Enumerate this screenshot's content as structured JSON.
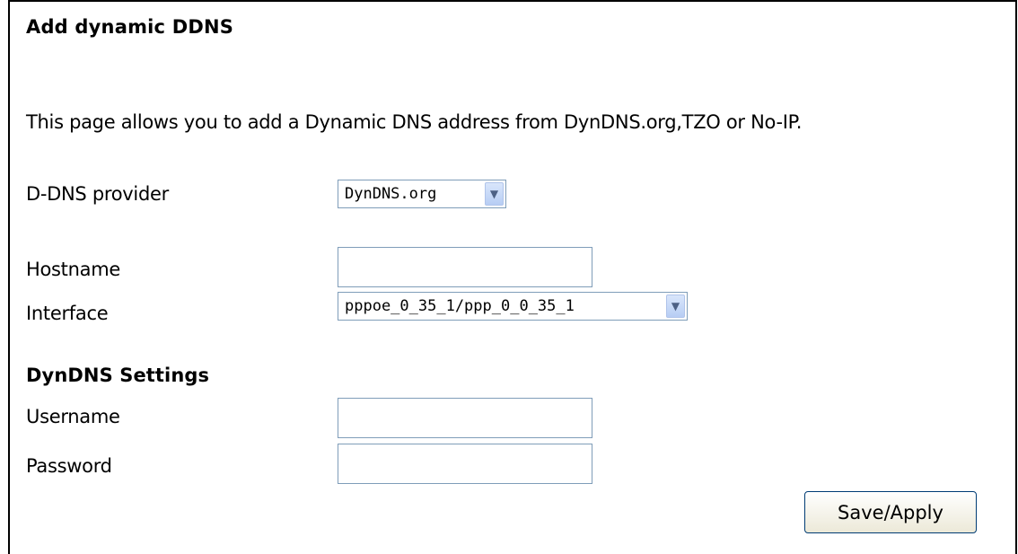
{
  "page": {
    "title": "Add dynamic DDNS",
    "description": "This page allows you to add a Dynamic DNS address from DynDNS.org,TZO or No-IP."
  },
  "form": {
    "provider_label": "D-DNS provider",
    "provider_value": "DynDNS.org",
    "hostname_label": "Hostname",
    "hostname_value": "",
    "interface_label": "Interface",
    "interface_value": "pppoe_0_35_1/ppp_0_0_35_1"
  },
  "dyndns": {
    "section_title": "DynDNS Settings",
    "username_label": "Username",
    "username_value": "",
    "password_label": "Password",
    "password_value": ""
  },
  "actions": {
    "save_label": "Save/Apply"
  },
  "icons": {
    "dropdown": "chevron-down-icon"
  }
}
